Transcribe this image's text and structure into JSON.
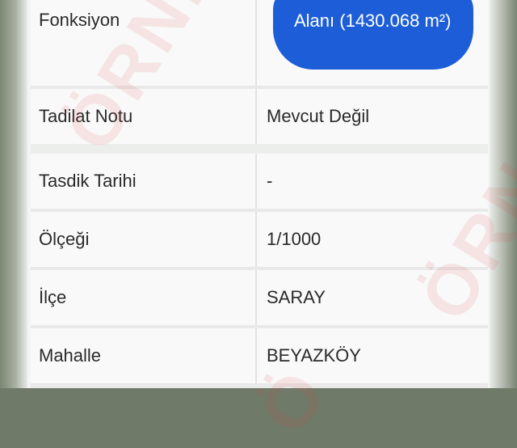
{
  "rows": [
    {
      "label": "Fonksiyon",
      "value": "Alanı (1430.068 m²)"
    },
    {
      "label": "Tadilat Notu",
      "value": "Mevcut Değil"
    },
    {
      "label": "Tasdik Tarihi",
      "value": "-"
    },
    {
      "label": "Ölçeği",
      "value": "1/1000"
    },
    {
      "label": "İlçe",
      "value": "SARAY"
    },
    {
      "label": "Mahalle",
      "value": "BEYAZKÖY"
    }
  ],
  "watermark": {
    "left": "ÖRNEKTİR",
    "right": "ÖRN",
    "bottom": "Ö"
  },
  "colors": {
    "badge": "#1d5ed8",
    "watermark": "#e63c3c"
  }
}
